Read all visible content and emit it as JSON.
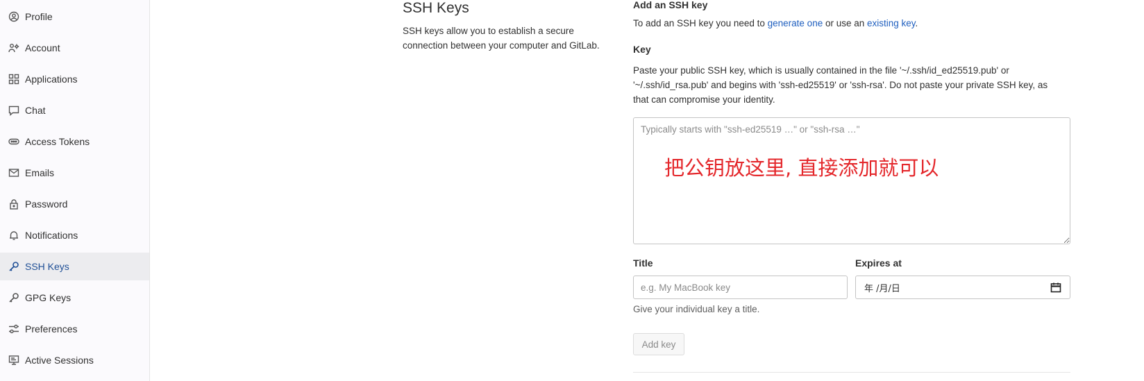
{
  "sidebar": {
    "items": [
      {
        "label": "Profile",
        "icon": "profile-icon",
        "active": false
      },
      {
        "label": "Account",
        "icon": "account-icon",
        "active": false
      },
      {
        "label": "Applications",
        "icon": "applications-icon",
        "active": false
      },
      {
        "label": "Chat",
        "icon": "chat-icon",
        "active": false
      },
      {
        "label": "Access Tokens",
        "icon": "token-icon",
        "active": false
      },
      {
        "label": "Emails",
        "icon": "mail-icon",
        "active": false
      },
      {
        "label": "Password",
        "icon": "lock-icon",
        "active": false
      },
      {
        "label": "Notifications",
        "icon": "bell-icon",
        "active": false
      },
      {
        "label": "SSH Keys",
        "icon": "key-icon",
        "active": true
      },
      {
        "label": "GPG Keys",
        "icon": "key-icon",
        "active": false
      },
      {
        "label": "Preferences",
        "icon": "preferences-icon",
        "active": false
      },
      {
        "label": "Active Sessions",
        "icon": "monitor-icon",
        "active": false
      }
    ]
  },
  "section": {
    "title": "SSH Keys",
    "description": "SSH keys allow you to establish a secure connection between your computer and GitLab."
  },
  "form": {
    "heading": "Add an SSH key",
    "help_prefix": "To add an SSH key you need to ",
    "generate_link": "generate one",
    "help_middle": " or use an ",
    "existing_link": "existing key",
    "help_suffix": ".",
    "key_label": "Key",
    "key_help": "Paste your public SSH key, which is usually contained in the file '~/.ssh/id_ed25519.pub' or '~/.ssh/id_rsa.pub' and begins with 'ssh-ed25519' or 'ssh-rsa'. Do not paste your private SSH key, as that can compromise your identity.",
    "key_placeholder": "Typically starts with \"ssh-ed25519 …\" or \"ssh-rsa …\"",
    "key_value": "",
    "annotation": "把公钥放这里, 直接添加就可以",
    "title_label": "Title",
    "title_placeholder": "e.g. My MacBook key",
    "title_value": "",
    "title_help": "Give your individual key a title.",
    "expires_label": "Expires at",
    "expires_value": "年 /月/日",
    "add_button": "Add key"
  },
  "colors": {
    "link": "#1f5fbf",
    "active_nav_bg": "#ececef",
    "active_nav_text": "#1f4f96",
    "annotation": "#e4272b"
  }
}
